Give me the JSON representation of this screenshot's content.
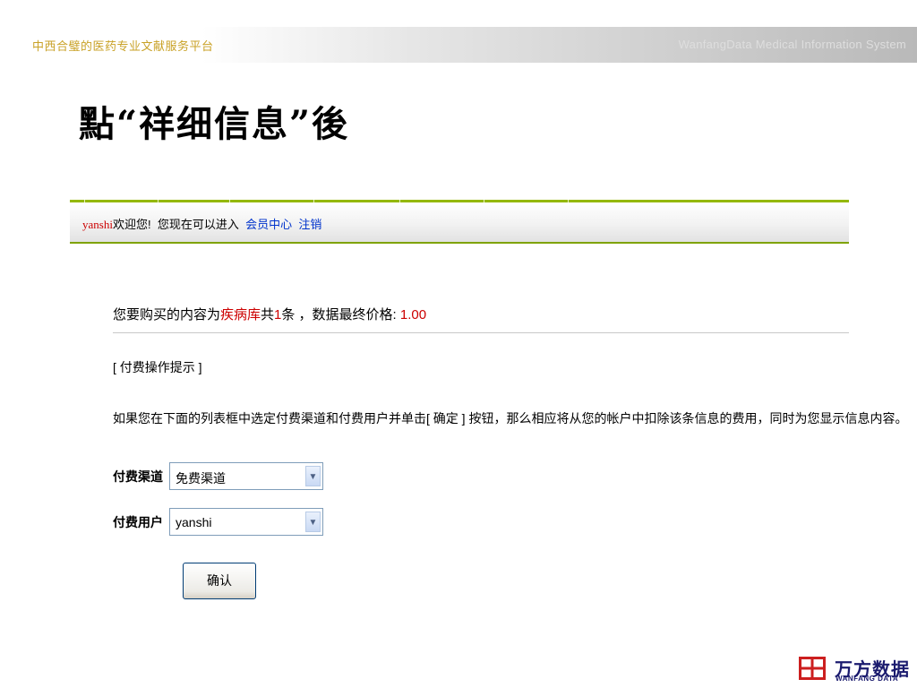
{
  "banner": {
    "left_text": "中西合璧的医药专业文献服务平台",
    "right_text": "WanfangData Medical Information System"
  },
  "slide": {
    "title": "點“祥细信息”後"
  },
  "header_bar": {
    "username": "yanshi",
    "welcome_text": "欢迎您!",
    "enter_text": "您现在可以进入",
    "member_center_link": "会员中心",
    "logout_link": "注销"
  },
  "purchase": {
    "prefix": "您要购买的内容为",
    "database": "疾病库",
    "count_prefix": "共",
    "count": "1",
    "count_suffix": "条 ，数据最终价格:",
    "price": "1.00"
  },
  "tips": {
    "title": "[ 付费操作提示 ]",
    "body": "如果您在下面的列表框中选定付费渠道和付费用户并单击[ 确定 ] 按钮，那么相应将从您的帐户中扣除该条信息的费用，同时为您显示信息内容。"
  },
  "form": {
    "channel_label": "付费渠道",
    "channel_value": "免费渠道",
    "user_label": "付费用户",
    "user_value": "yanshi",
    "confirm_label": "确认"
  },
  "logo": {
    "name_cn": "万方数据",
    "name_en": "WANFANG DATA"
  },
  "colors": {
    "accent_green": "#94b800",
    "link_blue": "#0033cc",
    "highlight_red": "#cc0000",
    "logo_red": "#cc1f1f",
    "logo_navy": "#1a1a6e"
  }
}
